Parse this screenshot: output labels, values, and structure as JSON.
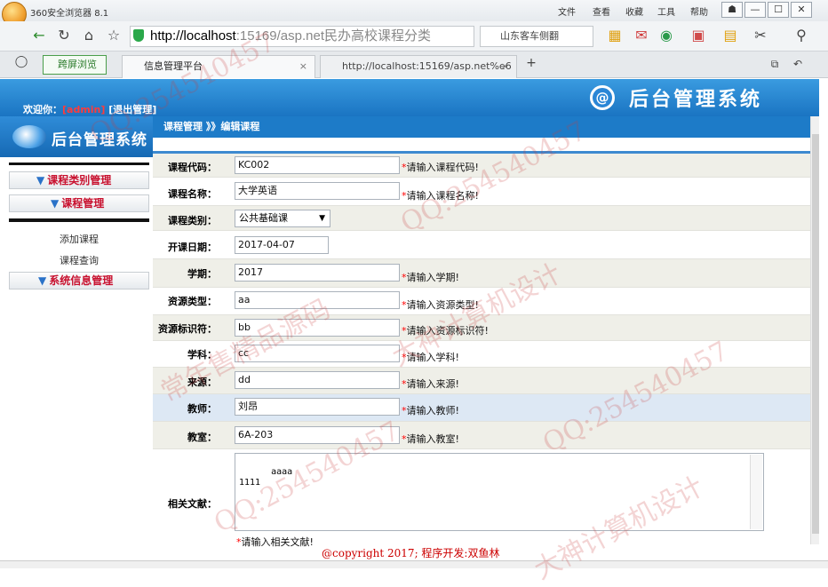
{
  "browser": {
    "app_title": "360安全浏览器 8.1",
    "menus": [
      "文件",
      "查看",
      "收藏",
      "工具",
      "帮助"
    ],
    "address_host": "http://localhost",
    "address_rest": ":15169/asp.net民办高校课程分类",
    "search_text": "山东客车侧翻",
    "split_button": "跨屏浏览",
    "tabs": [
      {
        "label": "信息管理平台",
        "active": true
      },
      {
        "label": "http://localhost:15169/asp.net%e6",
        "active": false
      }
    ],
    "new_tab": "+"
  },
  "header": {
    "welcome_prefix": "欢迎你：",
    "user": "[admin]",
    "logout": "[退出管理]",
    "system_title": "后台管理系统"
  },
  "sidebar": {
    "title": "后台管理系统",
    "items": [
      {
        "label": "课程类别管理"
      },
      {
        "label": "课程管理"
      },
      {
        "label": "系统信息管理"
      }
    ],
    "subitems": [
      "添加课程",
      "课程查询"
    ]
  },
  "breadcrumb": "课程管理 》》编辑课程",
  "form": {
    "code": {
      "label": "课程代码：",
      "value": "KC002",
      "hint": "请输入课程代码!"
    },
    "name": {
      "label": "课程名称：",
      "value": "大学英语",
      "hint": "请输入课程名称!"
    },
    "category": {
      "label": "课程类别：",
      "value": "公共基础课"
    },
    "date": {
      "label": "开课日期：",
      "value": "2017-04-07"
    },
    "term": {
      "label": "学期：",
      "value": "2017",
      "hint": "请输入学期!"
    },
    "restype": {
      "label": "资源类型：",
      "value": "aa",
      "hint": "请输入资源类型!"
    },
    "resid": {
      "label": "资源标识符：",
      "value": "bb",
      "hint": "请输入资源标识符!"
    },
    "subject": {
      "label": "学科：",
      "value": "cc",
      "hint": "请输入学科!"
    },
    "source": {
      "label": "来源：",
      "value": "dd",
      "hint": "请输入来源!"
    },
    "teacher": {
      "label": "教师：",
      "value": "刘昂",
      "hint": "请输入教师!"
    },
    "room": {
      "label": "教室：",
      "value": "6A-203",
      "hint": "请输入教室!"
    },
    "refs": {
      "label": "相关文献：",
      "value": "aaaa\n1111",
      "hint": "请输入相关文献!"
    }
  },
  "footer": {
    "copyright": "@copyright 2017; 程序开发:双鱼林"
  },
  "watermarks": [
    "QQ:254540457",
    "大神计算机设计",
    "常年售精品源码"
  ],
  "colors": {
    "header_blue": "#1d7bc8",
    "accent_red": "#c8102e",
    "required_red": "#ff0000"
  }
}
